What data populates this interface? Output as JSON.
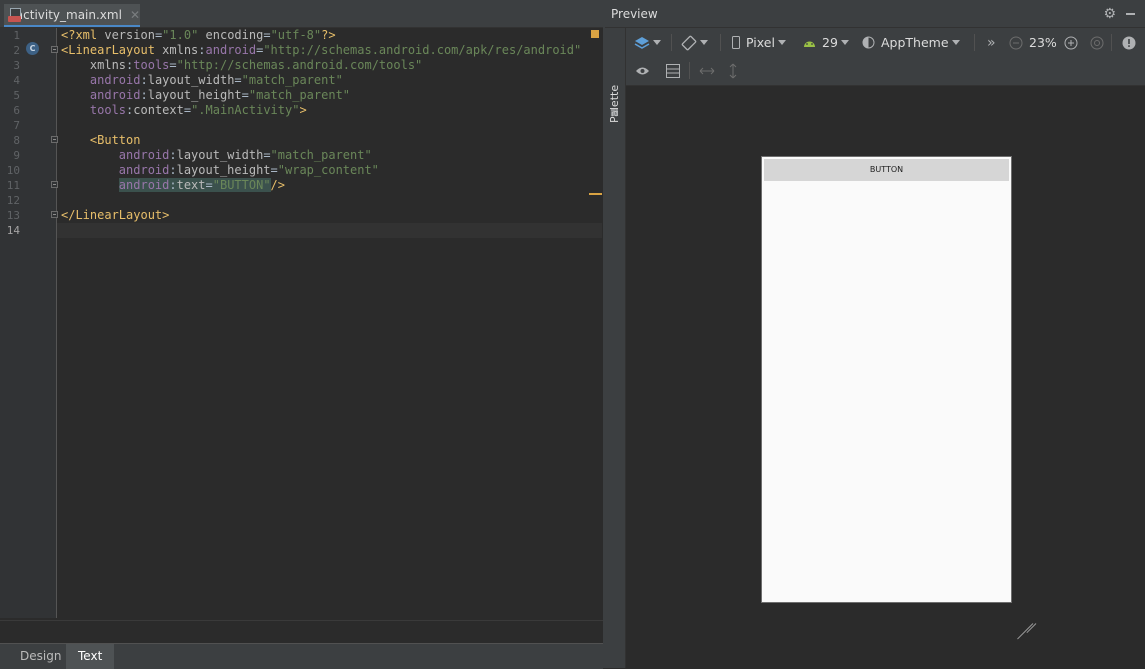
{
  "editor": {
    "tab_label": "activity_main.xml",
    "tab_close": "✕",
    "line_numbers": [
      "1",
      "2",
      "3",
      "4",
      "5",
      "6",
      "7",
      "8",
      "9",
      "10",
      "11",
      "12",
      "13",
      "14"
    ],
    "gutter_class_marker": "C"
  },
  "bottom_tabs": {
    "design": "Design",
    "text": "Text"
  },
  "preview": {
    "title": "Preview",
    "palette_label": "Palette",
    "device": "Pixel",
    "api_level": "29",
    "theme": "AppTheme",
    "zoom": "23%",
    "overflow": "»",
    "device_screen_button": "BUTTON"
  },
  "colors": {
    "tag": "#e8bf6a",
    "namespace": "#9876aa",
    "value": "#6a8759",
    "accent": "#4a88c7",
    "warning": "#d9a343"
  },
  "icons": [
    "layers-icon",
    "orientation-icon",
    "phone-icon",
    "android-icon",
    "theme-icon",
    "zoom-out-icon",
    "zoom-in-icon",
    "zoom-fit-icon",
    "warning-icon",
    "eye-icon",
    "blueprint-icon",
    "expand-horizontal-icon",
    "expand-vertical-icon",
    "gear-icon",
    "hide-icon"
  ]
}
